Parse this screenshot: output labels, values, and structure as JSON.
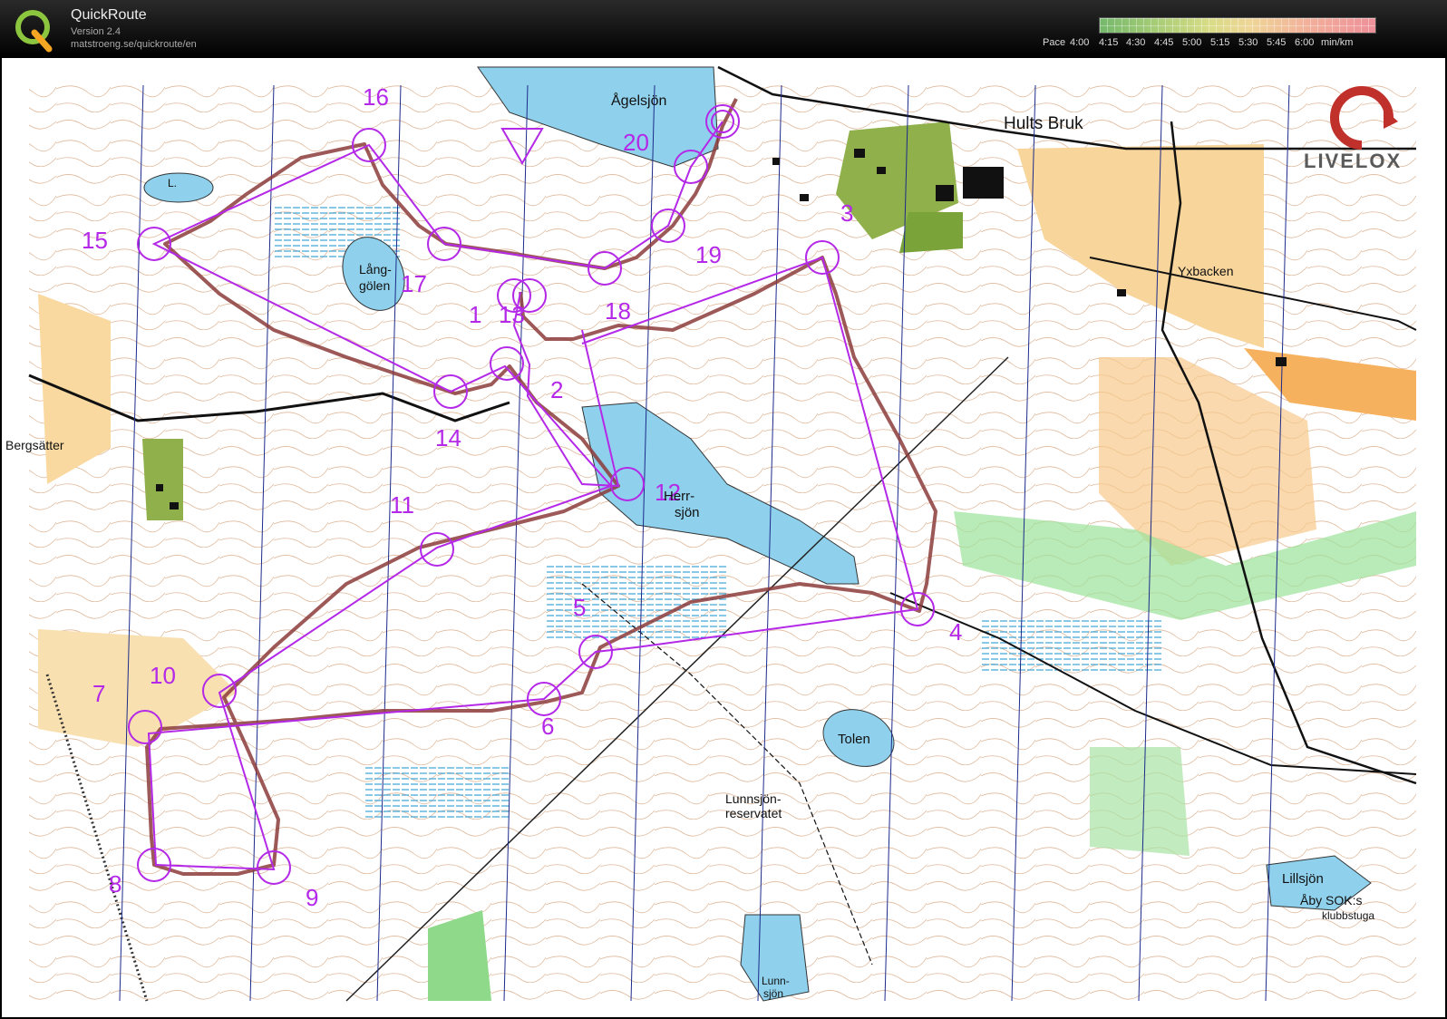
{
  "app": {
    "title": "QuickRoute",
    "version": "Version 2.4",
    "url": "matstroeng.se/quickroute/en"
  },
  "pace_scale": {
    "label": "Pace",
    "ticks": [
      "4:00",
      "4:15",
      "4:30",
      "4:45",
      "5:00",
      "5:15",
      "5:30",
      "5:45",
      "6:00"
    ],
    "unit": "min/km",
    "colors": [
      "#74b86b",
      "#a6cc76",
      "#d9dc86",
      "#efd598",
      "#f2b19a",
      "#ee8f99"
    ]
  },
  "brand": "LIVELOX",
  "map": {
    "place_names": {
      "agelsjon": "Ågelsjön",
      "hults_bruk": "Hults Bruk",
      "yxbacken": "Yxbacken",
      "bergsatter": "Bergsätter",
      "lang": "Lång-",
      "golen": "gölen",
      "herr": "Herr-",
      "sjon": "sjön",
      "tolen": "Tolen",
      "lunnsjon_res1": "Lunnsjön-",
      "lunnsjon_res2": "reservatet",
      "lillsjon": "Lillsjön",
      "aby1": "Åby SOK:s",
      "aby2": "klubbstuga",
      "lunn1": "Lunn-",
      "lunn2": "sjön",
      "l": "L."
    },
    "controls": [
      "1",
      "2",
      "3",
      "4",
      "5",
      "6",
      "7",
      "8",
      "9",
      "10",
      "11",
      "12",
      "13",
      "14",
      "15",
      "16",
      "17",
      "18",
      "19",
      "20"
    ],
    "colors": {
      "course": "#b428e8",
      "route": "#8c3b3b",
      "contour": "#c26a3d",
      "water": "#8fd1ec",
      "open": "#f7c46a",
      "green": "#7ed07a"
    }
  }
}
